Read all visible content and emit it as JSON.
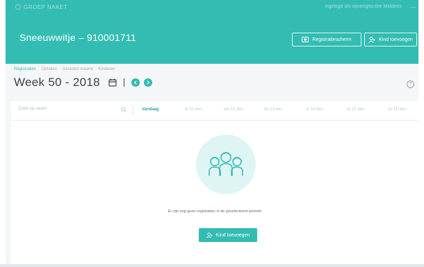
{
  "app": {
    "brand": "GROEP NAKET",
    "top_status": "ingelogd als opvanglocatie Middens",
    "top_close": "—"
  },
  "header": {
    "group_title": "Sneeuwwitje – 910001711",
    "registration_button": "Registratiescherm",
    "add_child_button": "Kind toevoegen"
  },
  "breadcrumb": {
    "items": [
      "Registraties",
      "Ophalen",
      "Gesloten maand",
      "Kinderen"
    ]
  },
  "week": {
    "title": "Week 50 - 2018",
    "separator": "|"
  },
  "help": {
    "label": "?"
  },
  "daybar": {
    "search_placeholder": "Zoek op naam",
    "days": [
      "Vandaag",
      "di 11 dec.",
      "wo 12 dec.",
      "do 13 dec.",
      "vr 14 dec.",
      "za 15 dec.",
      "zo 16 dec."
    ]
  },
  "empty_state": {
    "message": "Er zijn nog geen registraties in de geselecteerd periode",
    "button": "Kind toevoegen"
  },
  "colors": {
    "accent": "#33bcb2",
    "accent_light": "#dff5f3"
  },
  "icons": {
    "calendar": "calendar-icon",
    "prev": "chevron-left-icon",
    "next": "chevron-right-icon",
    "search": "search-icon",
    "add_user": "add-user-icon",
    "screen": "screen-icon",
    "help": "help-icon",
    "children": "children-group-icon"
  }
}
